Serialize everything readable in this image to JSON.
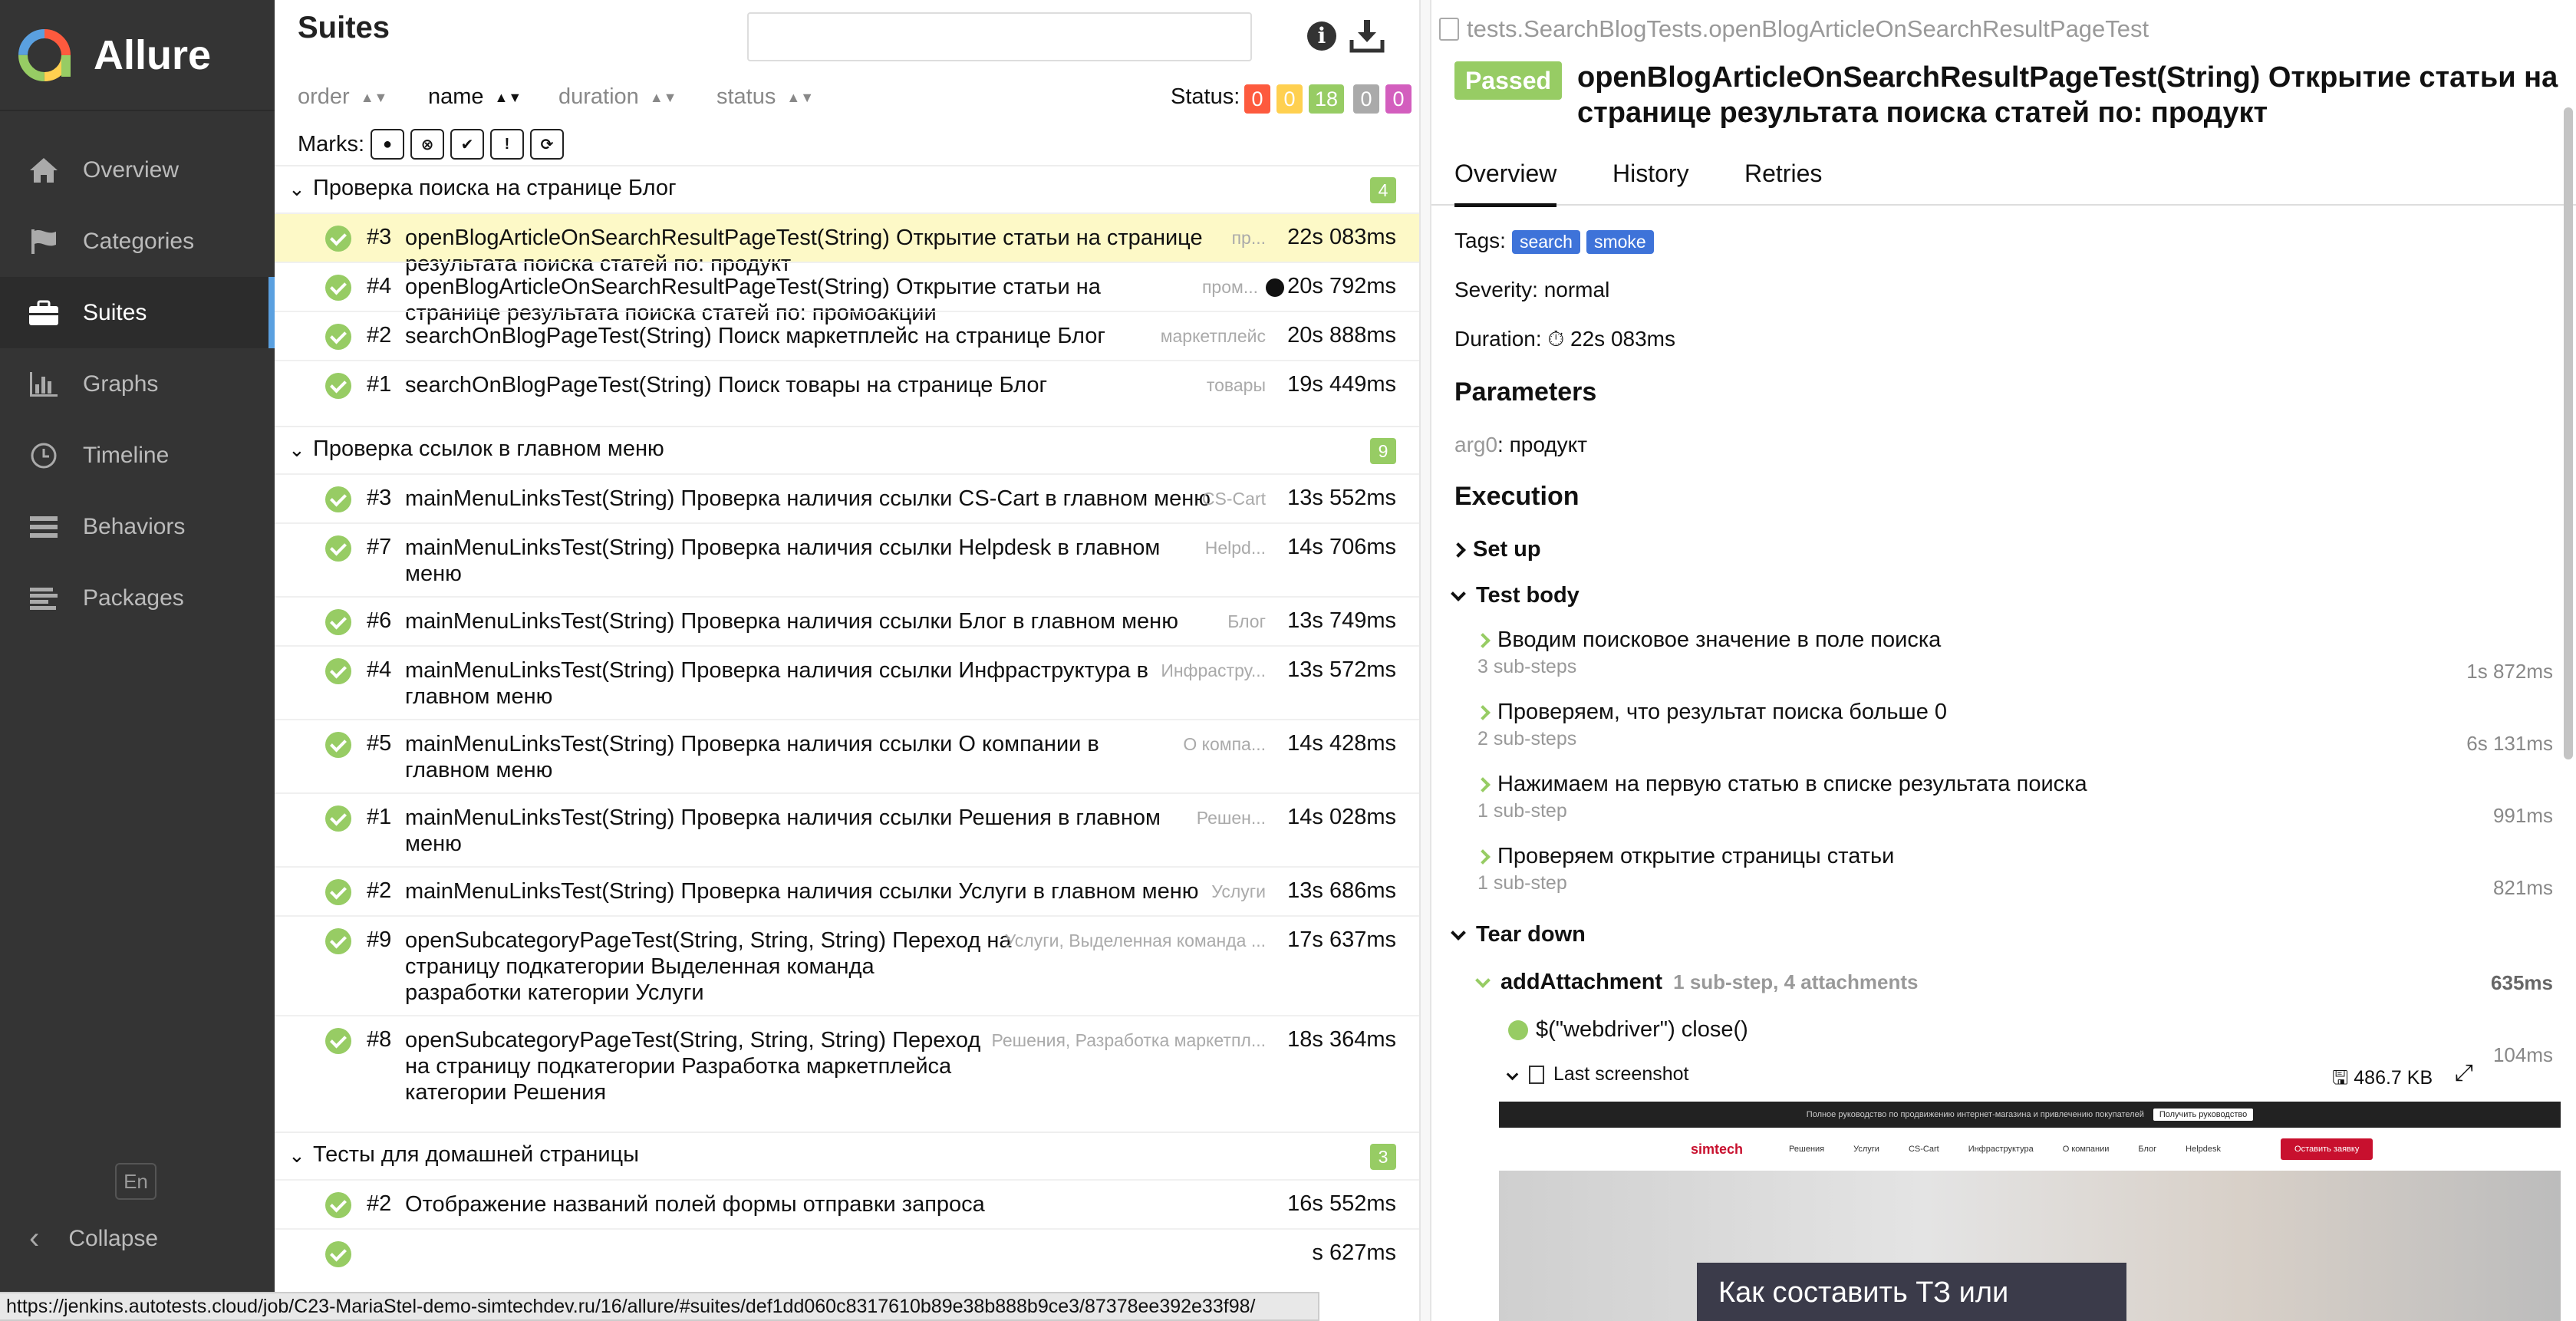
{
  "brand": {
    "name": "Allure"
  },
  "nav": [
    {
      "label": "Overview",
      "icon": "home-icon"
    },
    {
      "label": "Categories",
      "icon": "flag-icon"
    },
    {
      "label": "Suites",
      "icon": "briefcase-icon",
      "active": true
    },
    {
      "label": "Graphs",
      "icon": "bar-chart-icon"
    },
    {
      "label": "Timeline",
      "icon": "clock-icon"
    },
    {
      "label": "Behaviors",
      "icon": "list-icon"
    },
    {
      "label": "Packages",
      "icon": "align-left-icon"
    }
  ],
  "sidebar": {
    "lang": "En",
    "collapse": "Collapse"
  },
  "left": {
    "title": "Suites",
    "sort": {
      "order": "order",
      "name": "name",
      "duration": "duration",
      "status": "status"
    },
    "status_label": "Status:",
    "status_counts": [
      {
        "value": "0",
        "color": "#fd5a3e"
      },
      {
        "value": "0",
        "color": "#ffd050"
      },
      {
        "value": "18",
        "color": "#97cc64"
      },
      {
        "value": "0",
        "color": "#aaaaaa"
      },
      {
        "value": "0",
        "color": "#d35ebe"
      }
    ],
    "marks_label": "Marks:",
    "groups": [
      {
        "name": "Проверка поиска на странице Блог",
        "count": "4",
        "rows": [
          {
            "num": "#3",
            "line1": "openBlogArticleOnSearchResultPageTest(String) Открытие статьи на странице",
            "line2": "результата поиска статей по: продукт",
            "param": "пр...",
            "duration": "22s 083ms"
          },
          {
            "num": "#4",
            "line1": "openBlogArticleOnSearchResultPageTest(String) Открытие статьи на",
            "line2": "странице результата поиска статей по: промоакции",
            "param": "пром...",
            "duration": "20s 792ms"
          },
          {
            "num": "#2",
            "line1": "searchOnBlogPageTest(String) Поиск маркетплейс на странице Блог",
            "param": "маркетплейс",
            "duration": "20s 888ms"
          },
          {
            "num": "#1",
            "line1": "searchOnBlogPageTest(String) Поиск товары на странице Блог",
            "param": "товары",
            "duration": "19s 449ms"
          }
        ]
      },
      {
        "name": "Проверка ссылок в главном меню",
        "count": "9",
        "rows": [
          {
            "num": "#3",
            "line1": "mainMenuLinksTest(String) Проверка наличия ссылки CS-Cart в главном меню",
            "param": "CS-Cart",
            "duration": "13s 552ms"
          },
          {
            "num": "#7",
            "line1": "mainMenuLinksTest(String) Проверка наличия ссылки Helpdesk в главном",
            "line2": "меню",
            "param": "Helpd...",
            "duration": "14s 706ms"
          },
          {
            "num": "#6",
            "line1": "mainMenuLinksTest(String) Проверка наличия ссылки Блог в главном меню",
            "param": "Блог",
            "duration": "13s 749ms"
          },
          {
            "num": "#4",
            "line1": "mainMenuLinksTest(String) Проверка наличия ссылки Инфраструктура в",
            "line2": "главном меню",
            "param": "Инфрастру...",
            "duration": "13s 572ms"
          },
          {
            "num": "#5",
            "line1": "mainMenuLinksTest(String) Проверка наличия ссылки О компании в",
            "line2": "главном меню",
            "param": "О компа...",
            "duration": "14s 428ms"
          },
          {
            "num": "#1",
            "line1": "mainMenuLinksTest(String) Проверка наличия ссылки Решения в главном",
            "line2": "меню",
            "param": "Решен...",
            "duration": "14s 028ms"
          },
          {
            "num": "#2",
            "line1": "mainMenuLinksTest(String) Проверка наличия ссылки Услуги в главном меню",
            "param": "Услуги",
            "duration": "13s 686ms"
          },
          {
            "num": "#9",
            "line1": "openSubcategoryPageTest(String, String, String) Переход на",
            "line2": "страницу подкатегории Выделенная команда",
            "line3": "разработки категории Услуги",
            "param": "Услуги, Выделенная команда ...",
            "duration": "17s 637ms"
          },
          {
            "num": "#8",
            "line1": "openSubcategoryPageTest(String, String, String) Переход",
            "line2": "на страницу подкатегории Разработка маркетплейса",
            "line3": "категории Решения",
            "param": "Решения, Разработка маркетпл...",
            "duration": "18s 364ms"
          }
        ]
      },
      {
        "name": "Тесты для домашней страницы",
        "count": "3",
        "rows": [
          {
            "num": "#2",
            "line1": "Отображение названий полей формы отправки запроса",
            "param": "",
            "duration": "16s 552ms"
          },
          {
            "num": "",
            "line1": "",
            "param": "",
            "duration": "s 627ms"
          }
        ]
      }
    ]
  },
  "right": {
    "breadcrumb": "tests.SearchBlogTests.openBlogArticleOnSearchResultPageTest",
    "status": "Passed",
    "title": "openBlogArticleOnSearchResultPageTest(String) Открытие статьи на странице результата поиска статей по: продукт",
    "tabs": [
      "Overview",
      "History",
      "Retries"
    ],
    "tags_label": "Tags:",
    "tags": [
      "search",
      "smoke"
    ],
    "severity": "Severity: normal",
    "duration_label": "Duration:",
    "duration": "22s 083ms",
    "parameters_heading": "Parameters",
    "param_name": "arg0",
    "param_value": ": продукт",
    "execution_heading": "Execution",
    "setup": "Set up",
    "test_body": "Test body",
    "steps": [
      {
        "name": "Вводим поисковое значение в поле поиска",
        "sub": "3 sub-steps",
        "duration": "1s 872ms"
      },
      {
        "name": "Проверяем, что результат поиска больше 0",
        "sub": "2 sub-steps",
        "duration": "6s 131ms"
      },
      {
        "name": "Нажимаем на первую статью в списке результата поиска",
        "sub": "1 sub-step",
        "duration": "991ms"
      },
      {
        "name": "Проверяем открытие страницы статьи",
        "sub": "1 sub-step",
        "duration": "821ms"
      }
    ],
    "teardown": "Tear down",
    "add_attachment": "addAttachment",
    "add_attachment_meta": "1 sub-step, 4 attachments",
    "add_attachment_duration": "635ms",
    "webdriver_close": "$(\"webdriver\") close()",
    "webdriver_duration": "104ms",
    "screenshot_label": "Last screenshot",
    "screenshot_size": "486.7 KB",
    "screenshot": {
      "top_bar": "Полное руководство по продвижению интернет-магазина и привлечению покупателей",
      "top_button": "Получить руководство",
      "logo": "simtech",
      "menu": [
        "Решения",
        "Услуги",
        "CS-Cart",
        "Инфраструктура",
        "О компании",
        "Блог",
        "Helpdesk"
      ],
      "cta": "Оставить заявку",
      "card_text": "Как составить ТЗ или"
    }
  },
  "statusbar": {
    "url": "https://jenkins.autotests.cloud/job/C23-MariaStel-demo-simtechdev.ru/16/allure/#suites/def1dd060c8317610b89e38b888b9ce3/87378ee392e33f98/"
  }
}
